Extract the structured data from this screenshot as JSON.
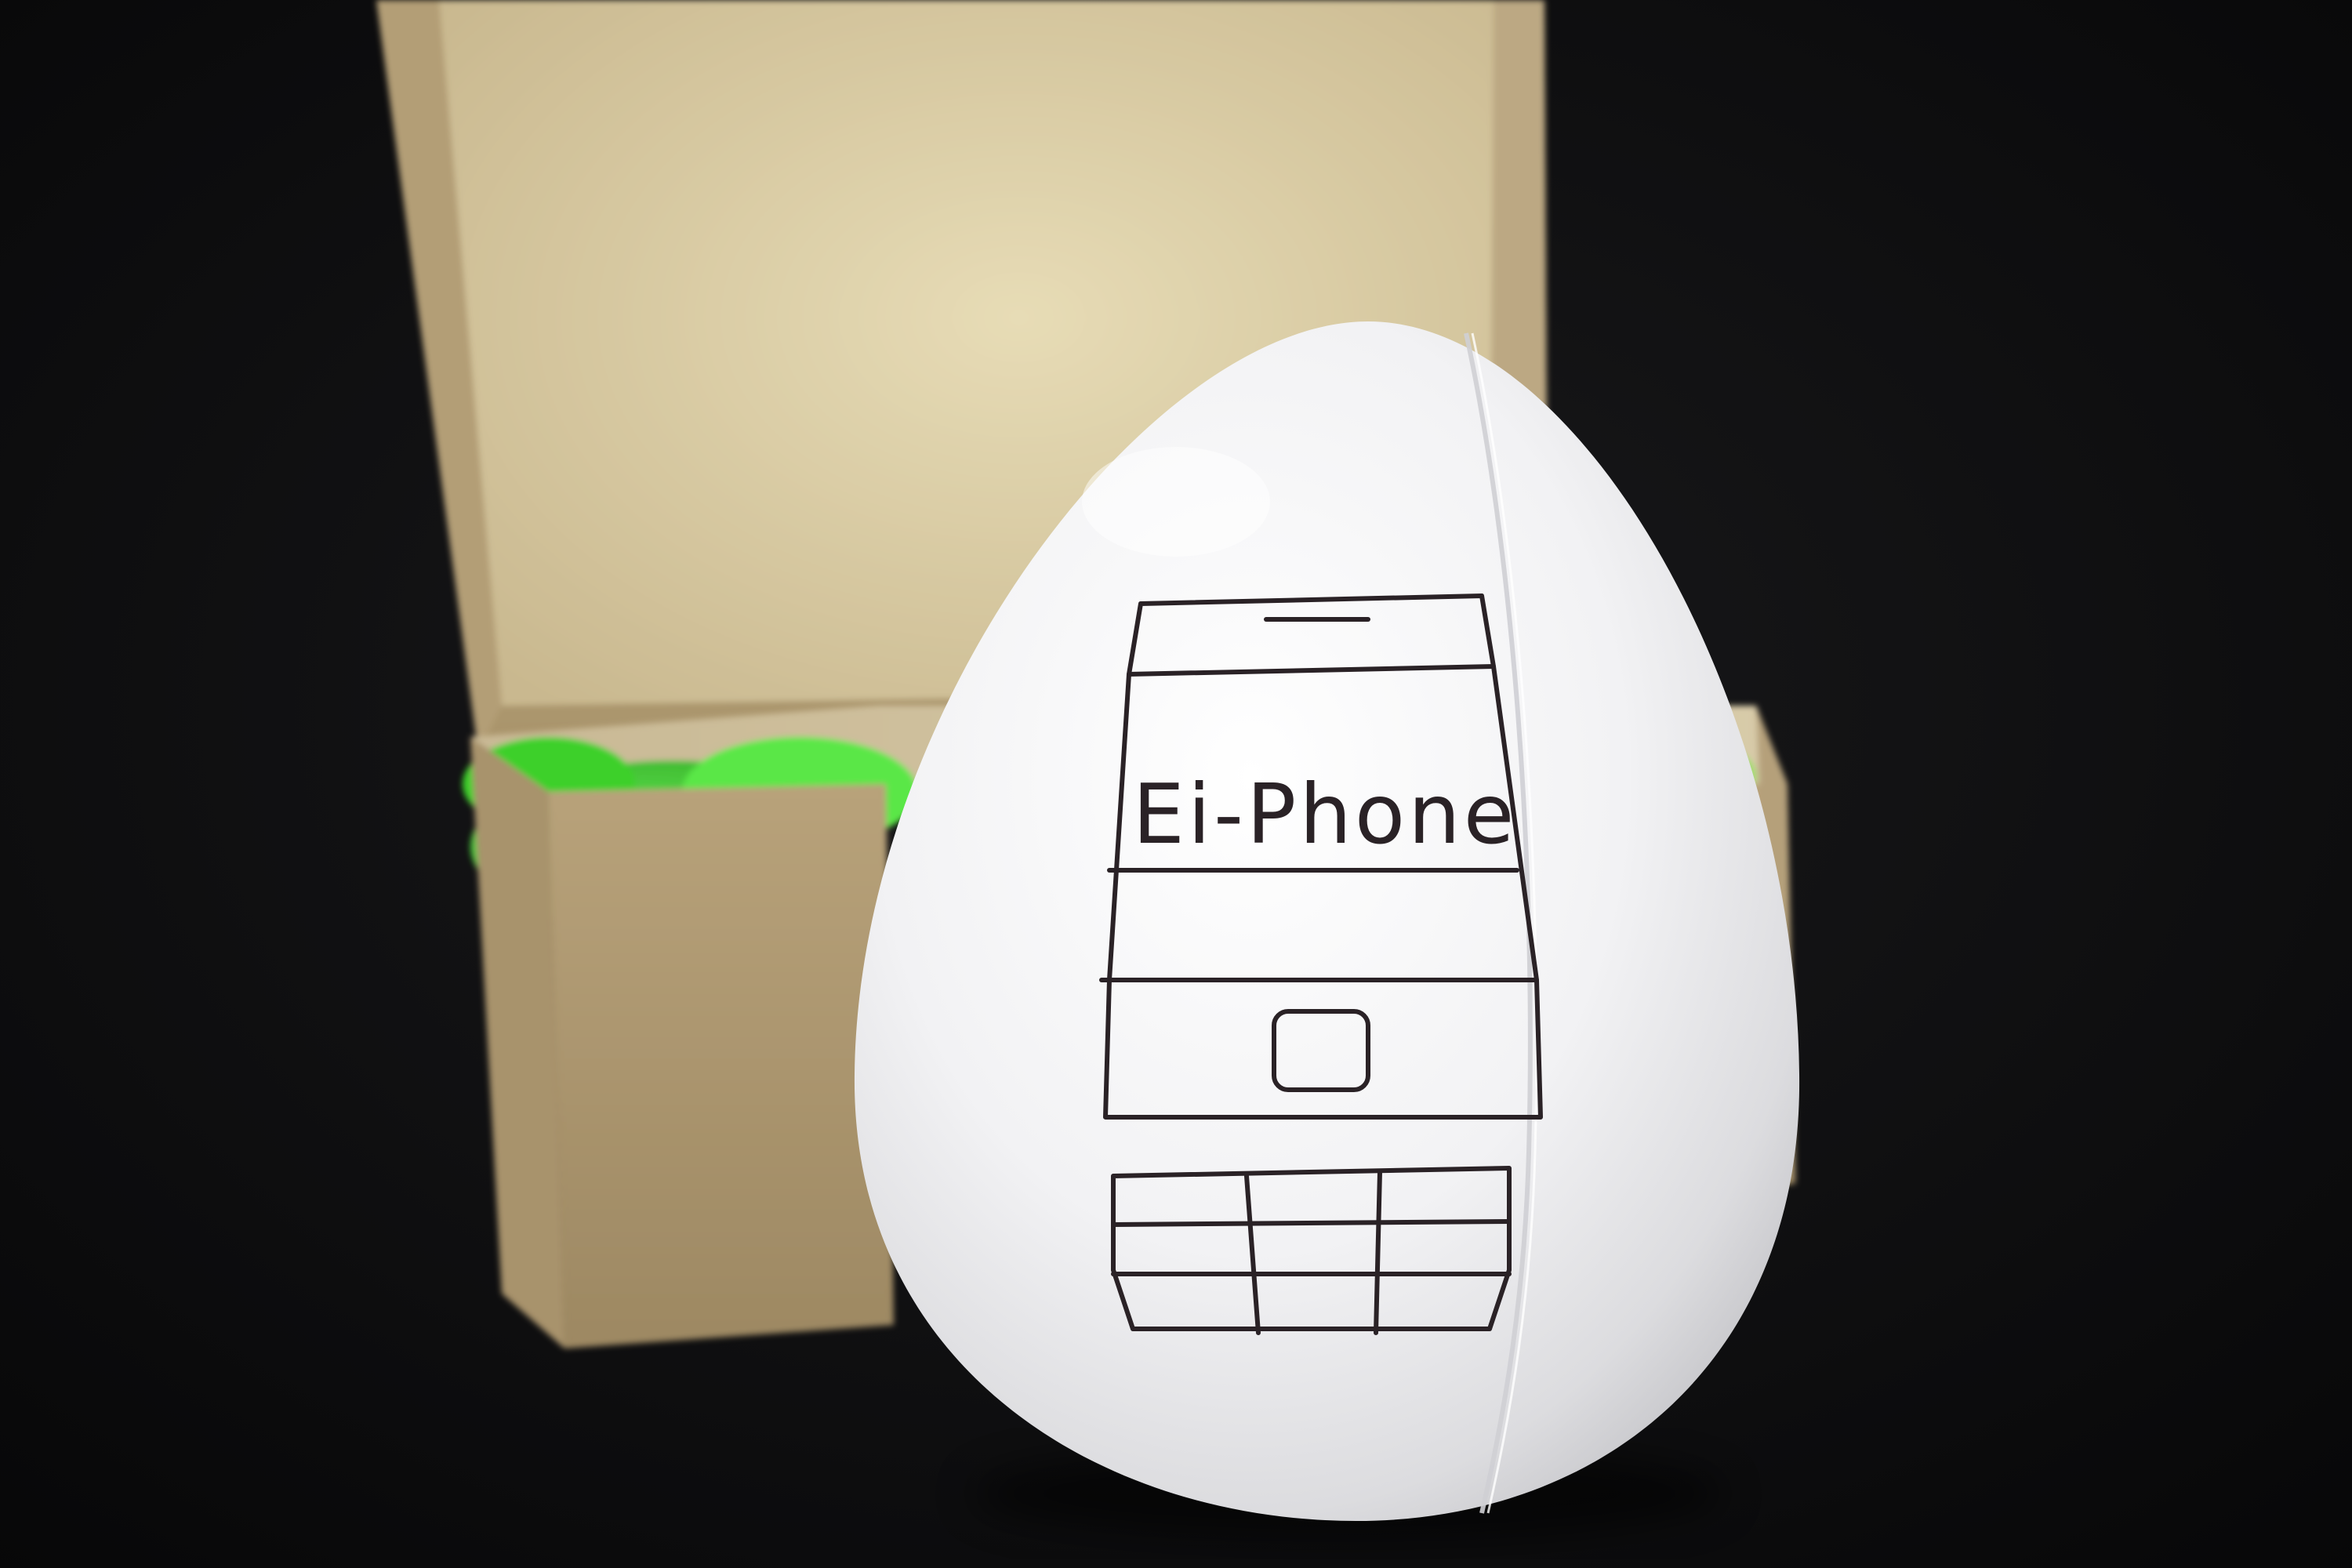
{
  "scene": {
    "egg_label": "Ei-Phone"
  },
  "colors": {
    "background": "#0b0b0c",
    "box_cardboard": "#b79f76",
    "box_interior": "#ddd0a6",
    "grass": "#4fe03a",
    "egg_shell": "#f4f4f6",
    "ink": "#2a2226"
  }
}
